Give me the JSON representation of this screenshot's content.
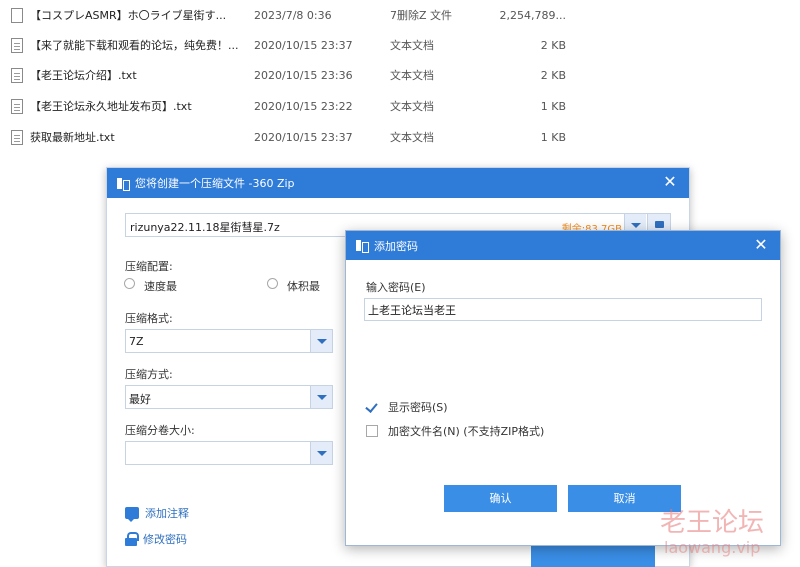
{
  "files": [
    {
      "name": "【コスプレASMR】ホ〇ライブ星街す...",
      "date": "2023/7/8 0:36",
      "type": "7删除Z 文件",
      "size": "2,254,789...",
      "icon": "blank-file-icon"
    },
    {
      "name": "【来了就能下载和观看的论坛，纯免费！...",
      "date": "2020/10/15 23:37",
      "type": "文本文档",
      "size": "2 KB",
      "icon": "text-file-icon"
    },
    {
      "name": "【老王论坛介绍】.txt",
      "date": "2020/10/15 23:36",
      "type": "文本文档",
      "size": "2 KB",
      "icon": "text-file-icon"
    },
    {
      "name": "【老王论坛永久地址发布页】.txt",
      "date": "2020/10/15 23:22",
      "type": "文本文档",
      "size": "1 KB",
      "icon": "text-file-icon"
    },
    {
      "name": "获取最新地址.txt",
      "date": "2020/10/15 23:37",
      "type": "文本文档",
      "size": "1 KB",
      "icon": "text-file-icon"
    }
  ],
  "zip_dialog": {
    "title": "您将创建一个压缩文件 -360 Zip",
    "path": "rizunya22.11.18星街彗星.7z",
    "space_left": "剩余:83.7GB",
    "compression_config_label": "压缩配置:",
    "speed_option": "速度最",
    "size_option": "体积最",
    "format_label": "压缩格式:",
    "format_value": "7Z",
    "method_label": "压缩方式:",
    "method_value": "最好",
    "volume_label": "压缩分卷大小:",
    "volume_value": "",
    "add_comment": "添加注释",
    "change_password": "修改密码"
  },
  "password_dialog": {
    "title": "添加密码",
    "input_label": "输入密码(E)",
    "password_value": "上老王论坛当老王",
    "show_password": "显示密码(S)",
    "encrypt_filenames": "加密文件名(N) (不支持ZIP格式)",
    "ok_button": "确认",
    "cancel_button": "取消"
  },
  "watermark": {
    "main": "老王论坛",
    "sub": "laowang.vip"
  },
  "colors": {
    "title_bar": "#2f7bd8",
    "button": "#3a8ee6",
    "space_left": "#f28c1e",
    "link": "#2f6fbf"
  }
}
